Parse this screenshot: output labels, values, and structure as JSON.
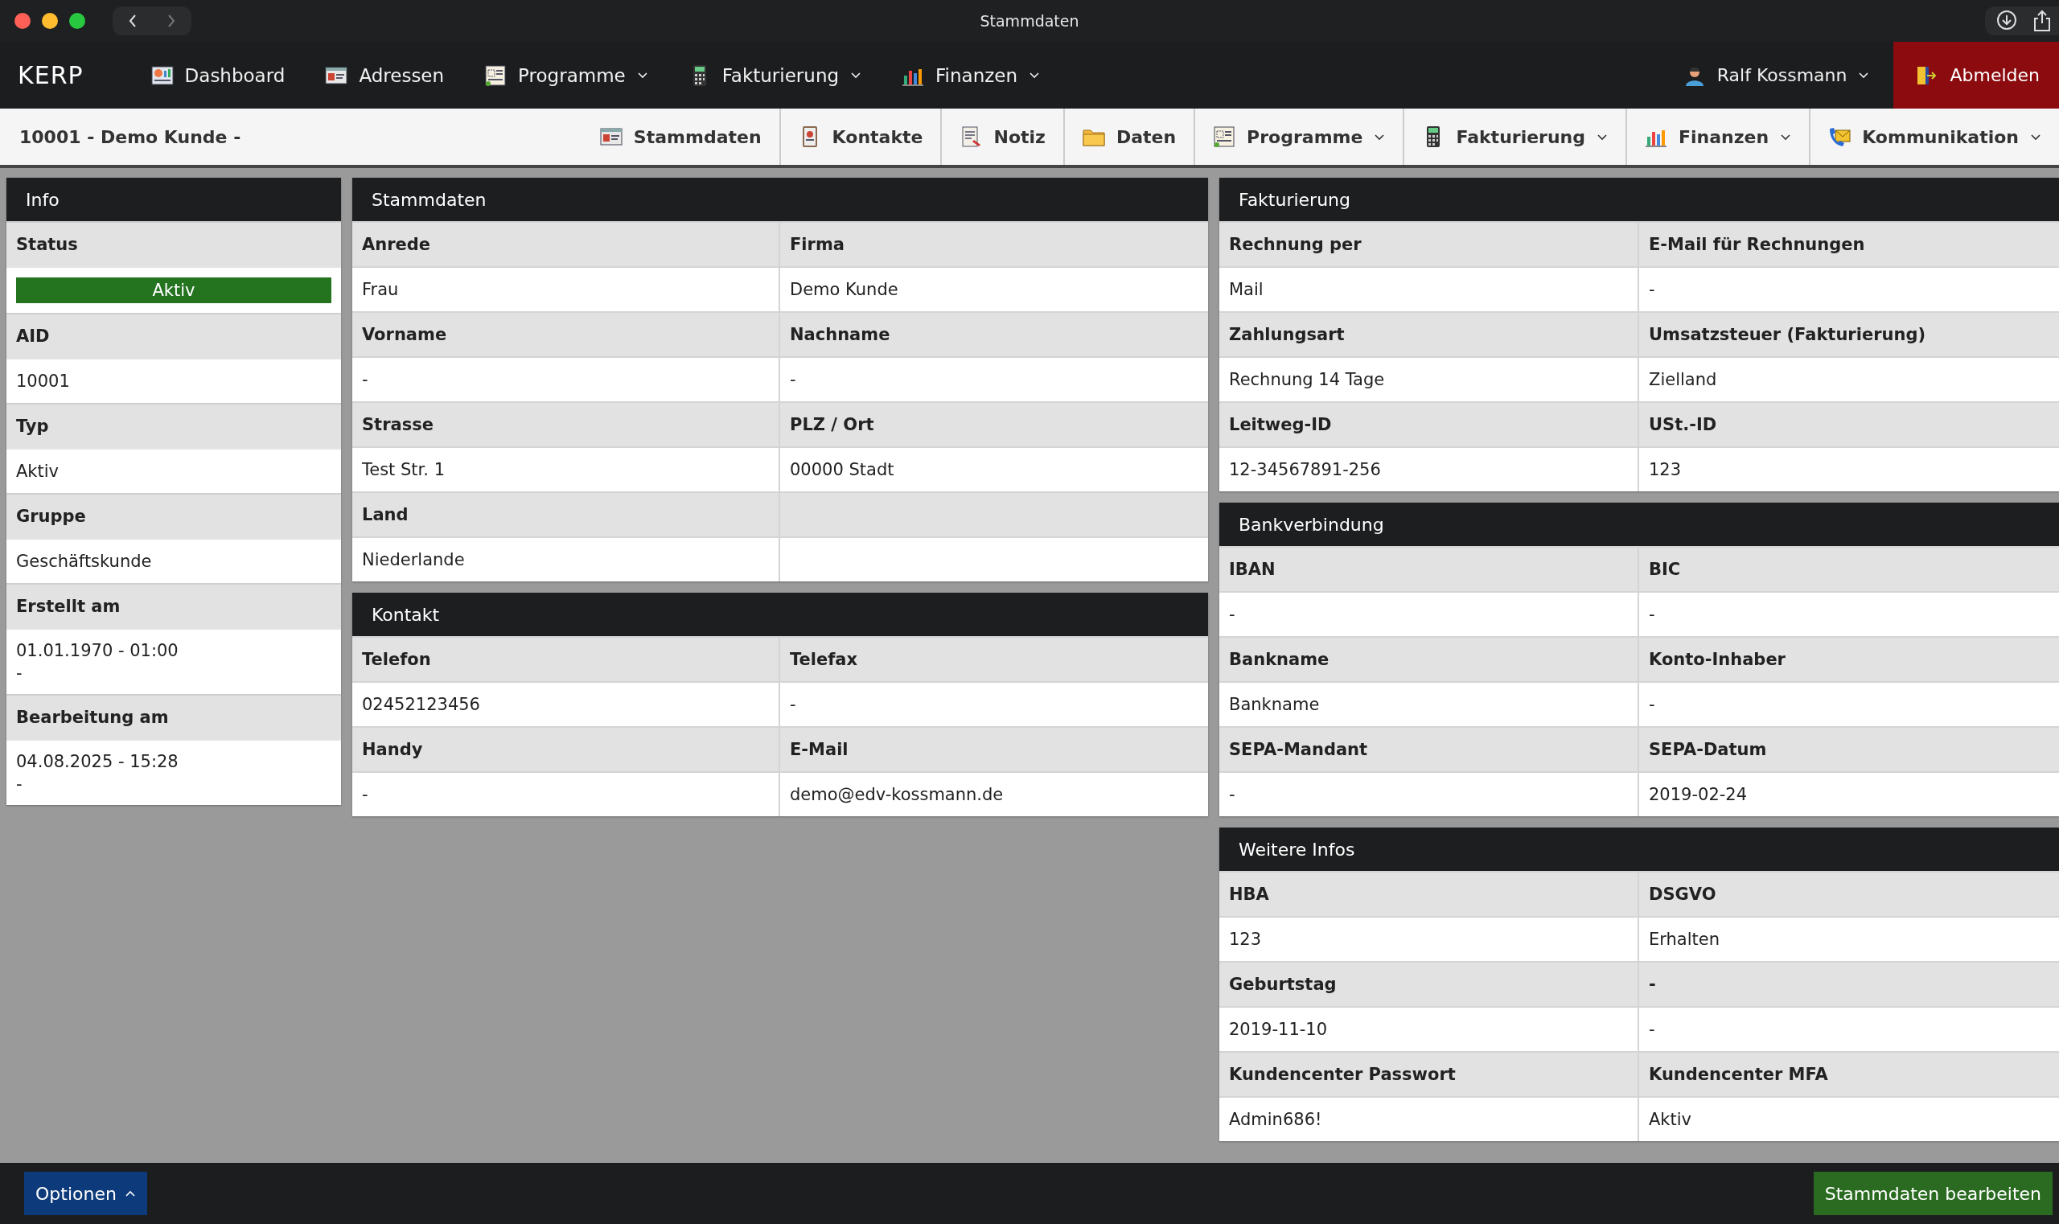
{
  "window": {
    "title": "Stammdaten"
  },
  "topnav": {
    "logo": "KERP",
    "items": [
      {
        "label": "Dashboard",
        "dropdown": false
      },
      {
        "label": "Adressen",
        "dropdown": false
      },
      {
        "label": "Programme",
        "dropdown": true
      },
      {
        "label": "Fakturierung",
        "dropdown": true
      },
      {
        "label": "Finanzen",
        "dropdown": true
      }
    ],
    "user": "Ralf Kossmann",
    "logout": "Abmelden"
  },
  "subnav": {
    "record": "10001 - Demo Kunde -",
    "items": [
      {
        "label": "Stammdaten",
        "dropdown": false
      },
      {
        "label": "Kontakte",
        "dropdown": false
      },
      {
        "label": "Notiz",
        "dropdown": false
      },
      {
        "label": "Daten",
        "dropdown": false
      },
      {
        "label": "Programme",
        "dropdown": true
      },
      {
        "label": "Fakturierung",
        "dropdown": true
      },
      {
        "label": "Finanzen",
        "dropdown": true
      },
      {
        "label": "Kommunikation",
        "dropdown": true
      }
    ]
  },
  "info": {
    "title": "Info",
    "items": [
      {
        "label": "Status",
        "kind": "badge",
        "value": [
          "Aktiv"
        ]
      },
      {
        "label": "AID",
        "kind": "text",
        "value": [
          "10001"
        ]
      },
      {
        "label": "Typ",
        "kind": "text",
        "value": [
          "Aktiv"
        ]
      },
      {
        "label": "Gruppe",
        "kind": "text",
        "value": [
          "Geschäftskunde"
        ]
      },
      {
        "label": "Erstellt am",
        "kind": "text",
        "value": [
          "01.01.1970 - 01:00",
          "-"
        ]
      },
      {
        "label": "Bearbeitung am",
        "kind": "text",
        "value": [
          "04.08.2025 - 15:28",
          "-"
        ]
      }
    ]
  },
  "middle": [
    {
      "title": "Stammdaten",
      "rows": [
        [
          [
            "Anrede",
            "Frau"
          ],
          [
            "Firma",
            "Demo Kunde"
          ]
        ],
        [
          [
            "Vorname",
            "-"
          ],
          [
            "Nachname",
            "-"
          ]
        ],
        [
          [
            "Strasse",
            "Test Str. 1"
          ],
          [
            "PLZ / Ort",
            "00000 Stadt"
          ]
        ],
        [
          [
            "Land",
            "Niederlande"
          ],
          [
            "",
            ""
          ]
        ]
      ]
    },
    {
      "title": "Kontakt",
      "rows": [
        [
          [
            "Telefon",
            "02452123456"
          ],
          [
            "Telefax",
            "-"
          ]
        ],
        [
          [
            "Handy",
            "-"
          ],
          [
            "E-Mail",
            "demo@edv-kossmann.de"
          ]
        ]
      ]
    }
  ],
  "right": [
    {
      "title": "Fakturierung",
      "rows": [
        [
          [
            "Rechnung per",
            "Mail"
          ],
          [
            "E-Mail für Rechnungen",
            "-"
          ]
        ],
        [
          [
            "Zahlungsart",
            "Rechnung 14 Tage"
          ],
          [
            "Umsatzsteuer (Fakturierung)",
            "Zielland"
          ]
        ],
        [
          [
            "Leitweg-ID",
            "12-34567891-256"
          ],
          [
            "USt.-ID",
            "123"
          ]
        ]
      ]
    },
    {
      "title": "Bankverbindung",
      "rows": [
        [
          [
            "IBAN",
            "-"
          ],
          [
            "BIC",
            "-"
          ]
        ],
        [
          [
            "Bankname",
            "Bankname"
          ],
          [
            "Konto-Inhaber",
            "-"
          ]
        ],
        [
          [
            "SEPA-Mandant",
            "-"
          ],
          [
            "SEPA-Datum",
            "2019-02-24"
          ]
        ]
      ]
    },
    {
      "title": "Weitere Infos",
      "rows": [
        [
          [
            "HBA",
            "123"
          ],
          [
            "DSGVO",
            "Erhalten"
          ]
        ],
        [
          [
            "Geburtstag",
            "2019-11-10"
          ],
          [
            "-",
            "-"
          ]
        ],
        [
          [
            "Kundencenter Passwort",
            "Admin686!"
          ],
          [
            "Kundencenter MFA",
            "Aktiv"
          ]
        ]
      ]
    }
  ],
  "footer": {
    "options": "Optionen",
    "edit": "Stammdaten bearbeiten"
  }
}
